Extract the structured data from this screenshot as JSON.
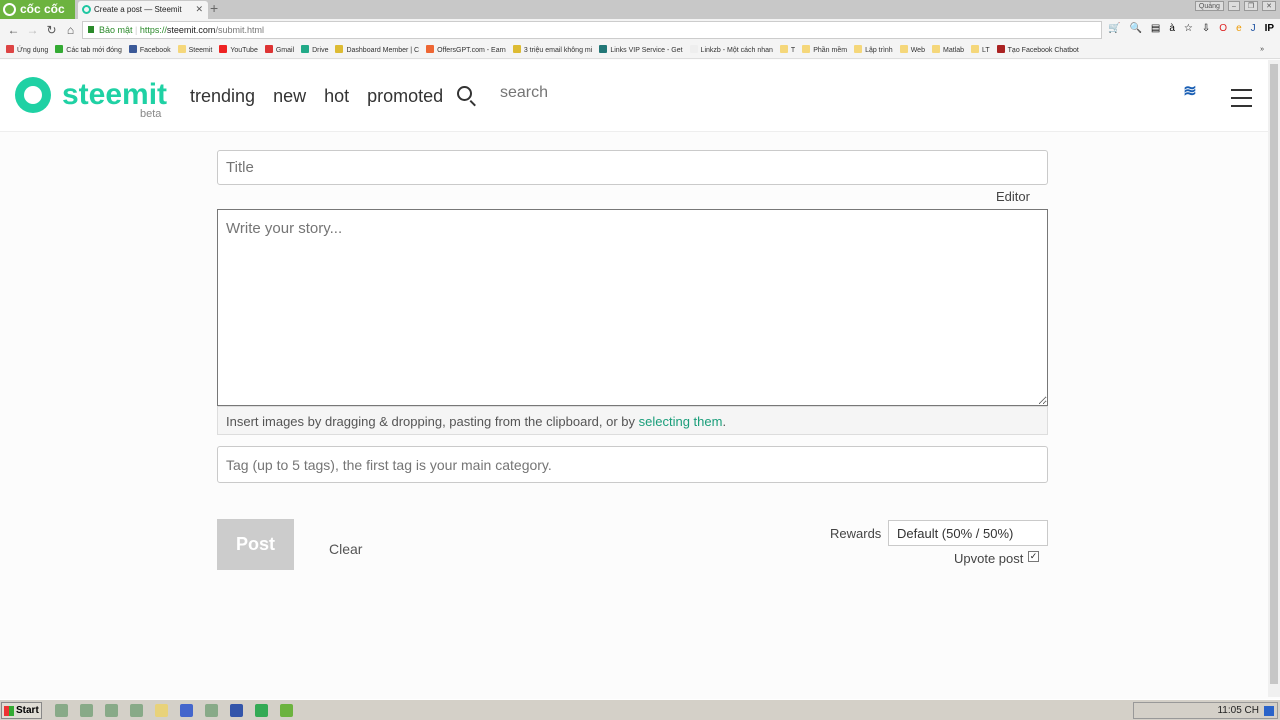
{
  "browser": {
    "brand": "cốc cốc",
    "tab_title": "Create a post — Steemit",
    "security_label": "Bảo mật",
    "url_scheme": "https://",
    "url_host": "steemit.com",
    "url_path": "/submit.html",
    "window_user": "Quảng",
    "bookmarks": [
      "Ứng dụng",
      "Các tab mới đóng",
      "Facebook",
      "Steemit",
      "YouTube",
      "Gmail",
      "Drive",
      "Dashboard Member | C",
      "OffersGPT.com - Earn",
      "3 triệu email không mi",
      "Links VIP Service - Get",
      "Linkzb - Một cách nhan",
      "T",
      "Phần mềm",
      "Lập trình",
      "Web",
      "Matlab",
      "LT",
      "Tạo Facebook Chatbot"
    ],
    "more": "»"
  },
  "header": {
    "logo": "steemit",
    "beta": "beta",
    "nav": [
      "trending",
      "new",
      "hot",
      "promoted"
    ],
    "search_placeholder": "search"
  },
  "form": {
    "title_placeholder": "Title",
    "editor_label": "Editor",
    "story_placeholder": "Write your story...",
    "hint_text": "Insert images by dragging & dropping, pasting from the clipboard, or by ",
    "hint_link": "selecting them",
    "hint_end": ".",
    "tags_placeholder": "Tag (up to 5 tags), the first tag is your main category.",
    "post_label": "Post",
    "clear_label": "Clear",
    "rewards_label": "Rewards",
    "rewards_value": "Default (50% / 50%)",
    "upvote_label": "Upvote post",
    "upvote_checked": true
  },
  "taskbar": {
    "start": "Start",
    "clock": "11:05 CH"
  },
  "colors": {
    "brand": "#1fd1a4",
    "link": "#1a9e7a"
  }
}
